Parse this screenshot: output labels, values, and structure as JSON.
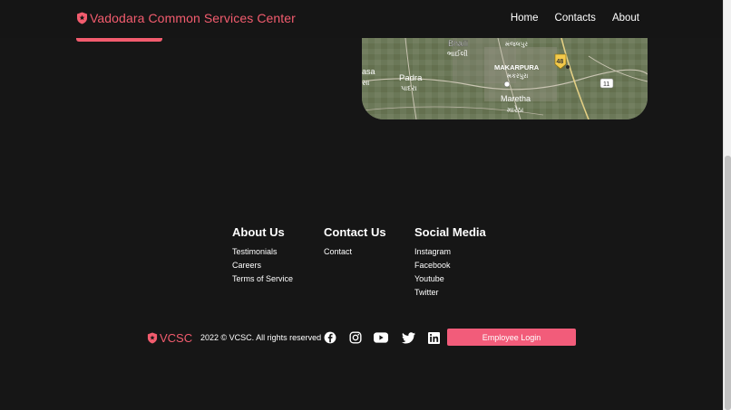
{
  "header": {
    "brand": "Vadodara Common Services Center",
    "nav": [
      "Home",
      "Contacts",
      "About"
    ]
  },
  "map": {
    "labels": {
      "bhaili": "Bhaili",
      "bhaili_guj": "ભાઈલી",
      "makarpura": "MAKARPURA",
      "makarpura_guj": "મકરપુરા",
      "manjalpur_guj": "મંજલપુર",
      "padra": "Padra",
      "padra_guj": "પાદરા",
      "maretha": "Maretha",
      "maretha_guj": "મારેઠા",
      "masa": "asa",
      "masa_guj": "સા",
      "highway_48": "48",
      "highway_11": "11"
    }
  },
  "footer": {
    "about": {
      "title": "About Us",
      "links": [
        "Testimonials",
        "Careers",
        "Terms of Service"
      ]
    },
    "contact": {
      "title": "Contact Us",
      "links": [
        "Contact"
      ]
    },
    "social": {
      "title": "Social Media",
      "links": [
        "Instagram",
        "Facebook",
        "Youtube",
        "Twitter"
      ]
    }
  },
  "bottom": {
    "logo": "VCSC",
    "copyright": "2022 © VCSC. All rights reserved",
    "login_label": "Employee Login",
    "icons": [
      "facebook-icon",
      "instagram-icon",
      "youtube-icon",
      "twitter-icon",
      "linkedin-icon"
    ]
  },
  "colors": {
    "background": "#161616",
    "accent": "#f25c6e",
    "button": "#f25c7a"
  }
}
